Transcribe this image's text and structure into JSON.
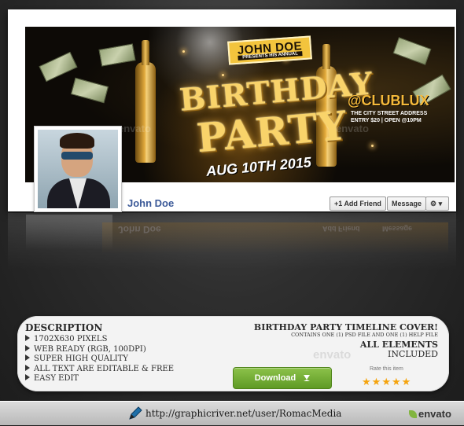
{
  "cover": {
    "brand_name": "JOHN DOE",
    "brand_sub": "PRESENTS HIS ANNUAL",
    "headline_line1": "BIRTHDAY",
    "headline_line2": "PARTY",
    "date": "AUG 10TH 2015",
    "venue": "@CLUBLUX",
    "venue_address": "THE CITY STREET ADDRESS",
    "venue_entry": "ENTRY $20 | OPEN @10PM",
    "watermark": "envato"
  },
  "profile": {
    "name": "John Doe",
    "add_friend_label": "Add Friend",
    "message_label": "Message",
    "gear_label": "⚙ ▾"
  },
  "panel": {
    "description_title": "DESCRIPTION",
    "features": [
      "1702X630 PIXELS",
      "WEB READY (RGB, 100DPI)",
      "SUPER HIGH QUALITY",
      "ALL TEXT ARE EDITABLE & FREE",
      "EASY EDIT"
    ],
    "product_title": "BIRTHDAY PARTY TIMELINE COVER!",
    "contains_text": "CONTAINS ONE (1) PSD FILE AND ONE (1) HELP FILE",
    "all_elements": "ALL ELEMENTS",
    "included": "INCLUDED",
    "watermark": "envato",
    "download_label": "Download",
    "rate_label": "Rate this item",
    "rating_stars": 5
  },
  "footer": {
    "url": "http://graphicriver.net/user/RomacMedia",
    "logo_text": "envato"
  },
  "colors": {
    "fb_link": "#3b5998",
    "download_green": "#6fab2f",
    "star_orange": "#f5a40e",
    "gold": "#f9d36a"
  }
}
